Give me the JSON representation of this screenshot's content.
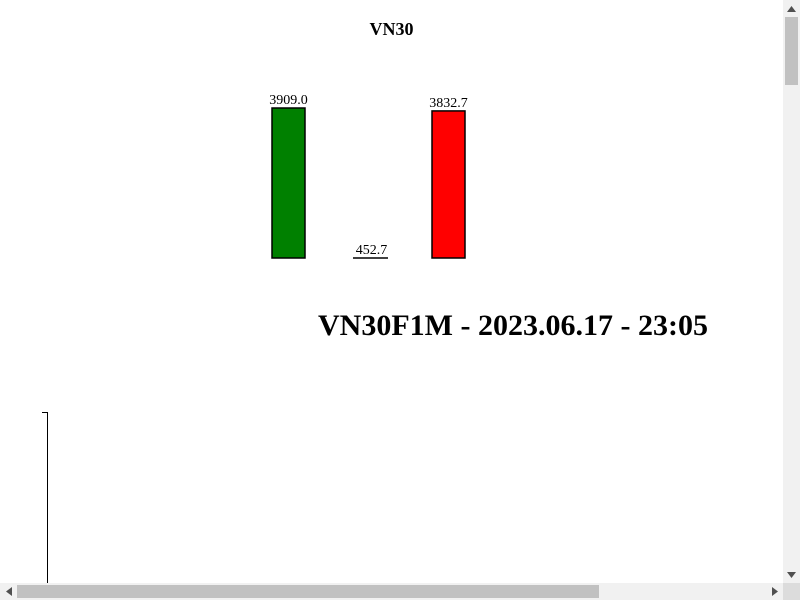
{
  "chart_data": {
    "type": "bar",
    "title": "VN30",
    "categories": [
      "",
      "",
      ""
    ],
    "values": [
      3909.0,
      452.7,
      3832.7
    ],
    "value_labels": [
      "3909.0",
      "452.7",
      "3832.7"
    ],
    "bar_colors": [
      "#008000",
      "#ffffff",
      "#ff0000"
    ],
    "xlabel": "",
    "ylabel": "",
    "grid": false
  },
  "heading": "VN30F1M - 2023.06.17 - 23:05",
  "icons": {
    "scroll_up": "triangle-up-icon",
    "scroll_down": "triangle-down-icon",
    "scroll_left": "triangle-left-icon",
    "scroll_right": "triangle-right-icon"
  }
}
